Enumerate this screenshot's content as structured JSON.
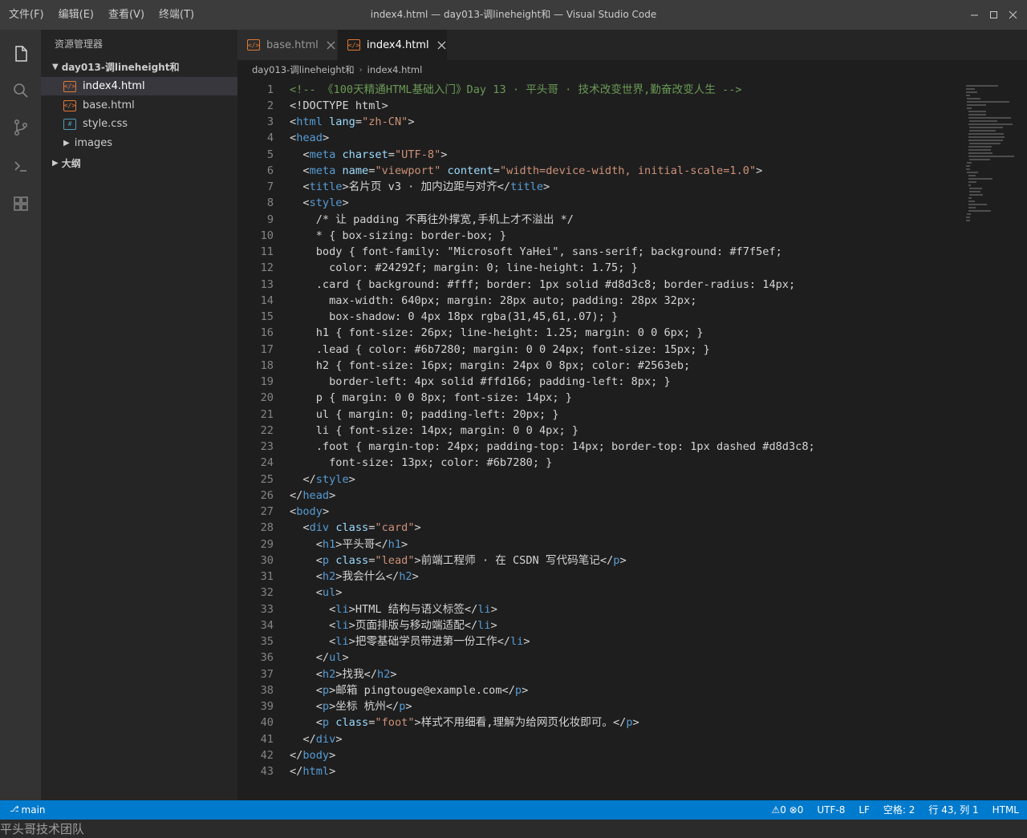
{
  "window": {
    "title": "index4.html — day013-调lineheight和 — Visual Studio Code",
    "menu": [
      "文件(F)",
      "编辑(E)",
      "查看(V)",
      "终端(T)"
    ]
  },
  "activity_bar": {
    "icons": [
      "files-icon",
      "search-icon",
      "source-control-icon",
      "terminal-icon",
      "extensions-icon"
    ]
  },
  "sidebar": {
    "title": "资源管理器",
    "folder": "day013-调lineheight和",
    "files": [
      {
        "name": "index4.html",
        "type": "html",
        "active": true
      },
      {
        "name": "base.html",
        "type": "html",
        "active": false
      },
      {
        "name": "style.css",
        "type": "css",
        "active": false
      }
    ],
    "images_folder": "images",
    "outline": "大纲"
  },
  "tabs": [
    {
      "label": "base.html",
      "active": false
    },
    {
      "label": "index4.html",
      "active": true
    }
  ],
  "breadcrumb": [
    "day013-调lineheight和",
    "index4.html"
  ],
  "editor": {
    "lines": [
      [
        [
          "com",
          "<!-- 《100天精通HTML基础入门》Day 13 · 平头哥 · 技术改变世界,勤奋改变人生 -->"
        ]
      ],
      [
        [
          "text",
          "<!DOCTYPE html>"
        ]
      ],
      [
        [
          "text",
          "<"
        ],
        [
          "tag",
          "html"
        ],
        [
          "text",
          " "
        ],
        [
          "attr",
          "lang"
        ],
        [
          "text",
          "="
        ],
        [
          "str",
          "\"zh-CN\""
        ],
        [
          "text",
          ">"
        ]
      ],
      [
        [
          "text",
          "<"
        ],
        [
          "tag",
          "head"
        ],
        [
          "text",
          ">"
        ]
      ],
      [
        [
          "text",
          "  <"
        ],
        [
          "tag",
          "meta"
        ],
        [
          "text",
          " "
        ],
        [
          "attr",
          "charset"
        ],
        [
          "text",
          "="
        ],
        [
          "str",
          "\"UTF-8\""
        ],
        [
          "text",
          ">"
        ]
      ],
      [
        [
          "text",
          "  <"
        ],
        [
          "tag",
          "meta"
        ],
        [
          "text",
          " "
        ],
        [
          "attr",
          "name"
        ],
        [
          "text",
          "="
        ],
        [
          "str",
          "\"viewport\""
        ],
        [
          "text",
          " "
        ],
        [
          "attr",
          "content"
        ],
        [
          "text",
          "="
        ],
        [
          "str",
          "\"width=device-width, initial-scale=1.0\""
        ],
        [
          "text",
          ">"
        ]
      ],
      [
        [
          "text",
          "  <"
        ],
        [
          "tag",
          "title"
        ],
        [
          "text",
          ">名片页 v3 · 加内边距与对齐</"
        ],
        [
          "tag",
          "title"
        ],
        [
          "text",
          ">"
        ]
      ],
      [
        [
          "text",
          "  <"
        ],
        [
          "tag",
          "style"
        ],
        [
          "text",
          ">"
        ]
      ],
      [
        [
          "text",
          "    /* 让 padding 不再往外撑宽,手机上才不溢出 */"
        ]
      ],
      [
        [
          "text",
          "    * { box-sizing: border-box; }"
        ]
      ],
      [
        [
          "text",
          "    body { font-family: \"Microsoft YaHei\", sans-serif; background: #f7f5ef;"
        ]
      ],
      [
        [
          "text",
          "      color: #24292f; margin: 0; line-height: 1.75; }"
        ]
      ],
      [
        [
          "text",
          "    .card { background: #fff; border: 1px solid #d8d3c8; border-radius: 14px;"
        ]
      ],
      [
        [
          "text",
          "      max-width: 640px; margin: 28px auto; padding: 28px 32px;"
        ]
      ],
      [
        [
          "text",
          "      box-shadow: 0 4px 18px rgba(31,45,61,.07); }"
        ]
      ],
      [
        [
          "text",
          "    h1 { font-size: 26px; line-height: 1.25; margin: 0 0 6px; }"
        ]
      ],
      [
        [
          "text",
          "    .lead { color: #6b7280; margin: 0 0 24px; font-size: 15px; }"
        ]
      ],
      [
        [
          "text",
          "    h2 { font-size: 16px; margin: 24px 0 8px; color: #2563eb;"
        ]
      ],
      [
        [
          "text",
          "      border-left: 4px solid #ffd166; padding-left: 8px; }"
        ]
      ],
      [
        [
          "text",
          "    p { margin: 0 0 8px; font-size: 14px; }"
        ]
      ],
      [
        [
          "text",
          "    ul { margin: 0; padding-left: 20px; }"
        ]
      ],
      [
        [
          "text",
          "    li { font-size: 14px; margin: 0 0 4px; }"
        ]
      ],
      [
        [
          "text",
          "    .foot { margin-top: 24px; padding-top: 14px; border-top: 1px dashed #d8d3c8;"
        ]
      ],
      [
        [
          "text",
          "      font-size: 13px; color: #6b7280; }"
        ]
      ],
      [
        [
          "text",
          "  </"
        ],
        [
          "tag",
          "style"
        ],
        [
          "text",
          ">"
        ]
      ],
      [
        [
          "text",
          "</"
        ],
        [
          "tag",
          "head"
        ],
        [
          "text",
          ">"
        ]
      ],
      [
        [
          "text",
          "<"
        ],
        [
          "tag",
          "body"
        ],
        [
          "text",
          ">"
        ]
      ],
      [
        [
          "text",
          "  <"
        ],
        [
          "tag",
          "div"
        ],
        [
          "text",
          " "
        ],
        [
          "attr",
          "class"
        ],
        [
          "text",
          "="
        ],
        [
          "str",
          "\"card\""
        ],
        [
          "text",
          ">"
        ]
      ],
      [
        [
          "text",
          "    <"
        ],
        [
          "tag",
          "h1"
        ],
        [
          "text",
          ">平头哥</"
        ],
        [
          "tag",
          "h1"
        ],
        [
          "text",
          ">"
        ]
      ],
      [
        [
          "text",
          "    <"
        ],
        [
          "tag",
          "p"
        ],
        [
          "text",
          " "
        ],
        [
          "attr",
          "class"
        ],
        [
          "text",
          "="
        ],
        [
          "str",
          "\"lead\""
        ],
        [
          "text",
          ">前端工程师 · 在 CSDN 写代码笔记</"
        ],
        [
          "tag",
          "p"
        ],
        [
          "text",
          ">"
        ]
      ],
      [
        [
          "text",
          "    <"
        ],
        [
          "tag",
          "h2"
        ],
        [
          "text",
          ">我会什么</"
        ],
        [
          "tag",
          "h2"
        ],
        [
          "text",
          ">"
        ]
      ],
      [
        [
          "text",
          "    <"
        ],
        [
          "tag",
          "ul"
        ],
        [
          "text",
          ">"
        ]
      ],
      [
        [
          "text",
          "      <"
        ],
        [
          "tag",
          "li"
        ],
        [
          "text",
          ">HTML 结构与语义标签</"
        ],
        [
          "tag",
          "li"
        ],
        [
          "text",
          ">"
        ]
      ],
      [
        [
          "text",
          "      <"
        ],
        [
          "tag",
          "li"
        ],
        [
          "text",
          ">页面排版与移动端适配</"
        ],
        [
          "tag",
          "li"
        ],
        [
          "text",
          ">"
        ]
      ],
      [
        [
          "text",
          "      <"
        ],
        [
          "tag",
          "li"
        ],
        [
          "text",
          ">把零基础学员带进第一份工作</"
        ],
        [
          "tag",
          "li"
        ],
        [
          "text",
          ">"
        ]
      ],
      [
        [
          "text",
          "    </"
        ],
        [
          "tag",
          "ul"
        ],
        [
          "text",
          ">"
        ]
      ],
      [
        [
          "text",
          "    <"
        ],
        [
          "tag",
          "h2"
        ],
        [
          "text",
          ">找我</"
        ],
        [
          "tag",
          "h2"
        ],
        [
          "text",
          ">"
        ]
      ],
      [
        [
          "text",
          "    <"
        ],
        [
          "tag",
          "p"
        ],
        [
          "text",
          ">邮箱 pingtouge@example.com</"
        ],
        [
          "tag",
          "p"
        ],
        [
          "text",
          ">"
        ]
      ],
      [
        [
          "text",
          "    <"
        ],
        [
          "tag",
          "p"
        ],
        [
          "text",
          ">坐标 杭州</"
        ],
        [
          "tag",
          "p"
        ],
        [
          "text",
          ">"
        ]
      ],
      [
        [
          "text",
          "    <"
        ],
        [
          "tag",
          "p"
        ],
        [
          "text",
          " "
        ],
        [
          "attr",
          "class"
        ],
        [
          "text",
          "="
        ],
        [
          "str",
          "\"foot\""
        ],
        [
          "text",
          ">样式不用细看,理解为给网页化妆即可。</"
        ],
        [
          "tag",
          "p"
        ],
        [
          "text",
          ">"
        ]
      ],
      [
        [
          "text",
          "  </"
        ],
        [
          "tag",
          "div"
        ],
        [
          "text",
          ">"
        ]
      ],
      [
        [
          "text",
          "</"
        ],
        [
          "tag",
          "body"
        ],
        [
          "text",
          ">"
        ]
      ],
      [
        [
          "text",
          "</"
        ],
        [
          "tag",
          "html"
        ],
        [
          "text",
          ">"
        ]
      ]
    ]
  },
  "status_bar": {
    "branch": "main",
    "problems": "⚠0 ⊗0",
    "encoding": "UTF-8",
    "eol": "LF",
    "indent": "空格: 2",
    "position": "行 43, 列 1",
    "language": "HTML"
  },
  "watermark": "平头哥技术团队",
  "colors": {
    "accent": "#007acc",
    "tag": "#569cd6",
    "attr": "#9cdcfe",
    "string": "#ce9178",
    "comment": "#6a9955",
    "html_icon": "#e37933",
    "css_icon": "#519aba"
  }
}
